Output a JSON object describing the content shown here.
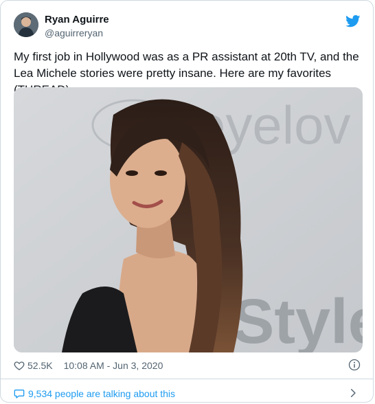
{
  "author": {
    "name": "Ryan Aguirre",
    "handle": "@aguirreryan"
  },
  "tweet": {
    "text": "My first job in Hollywood was as a PR assistant at 20th TV, and the Lea Michele stories were pretty insane. Here are my favorites (THREAD):"
  },
  "media": {
    "backdrop_text_1": "eyelov",
    "backdrop_text_2": "Style"
  },
  "stats": {
    "likes": "52.5K",
    "timestamp": "10:08 AM - Jun 3, 2020"
  },
  "footer": {
    "conversation_label": "9,534 people are talking about this"
  },
  "colors": {
    "accent": "#1d9bf0",
    "text": "#0f1419",
    "muted": "#536471",
    "border": "#cfd9de"
  },
  "icons": [
    "twitter-bird-icon",
    "heart-icon",
    "info-icon",
    "comment-bubble-icon",
    "chevron-right-icon"
  ]
}
